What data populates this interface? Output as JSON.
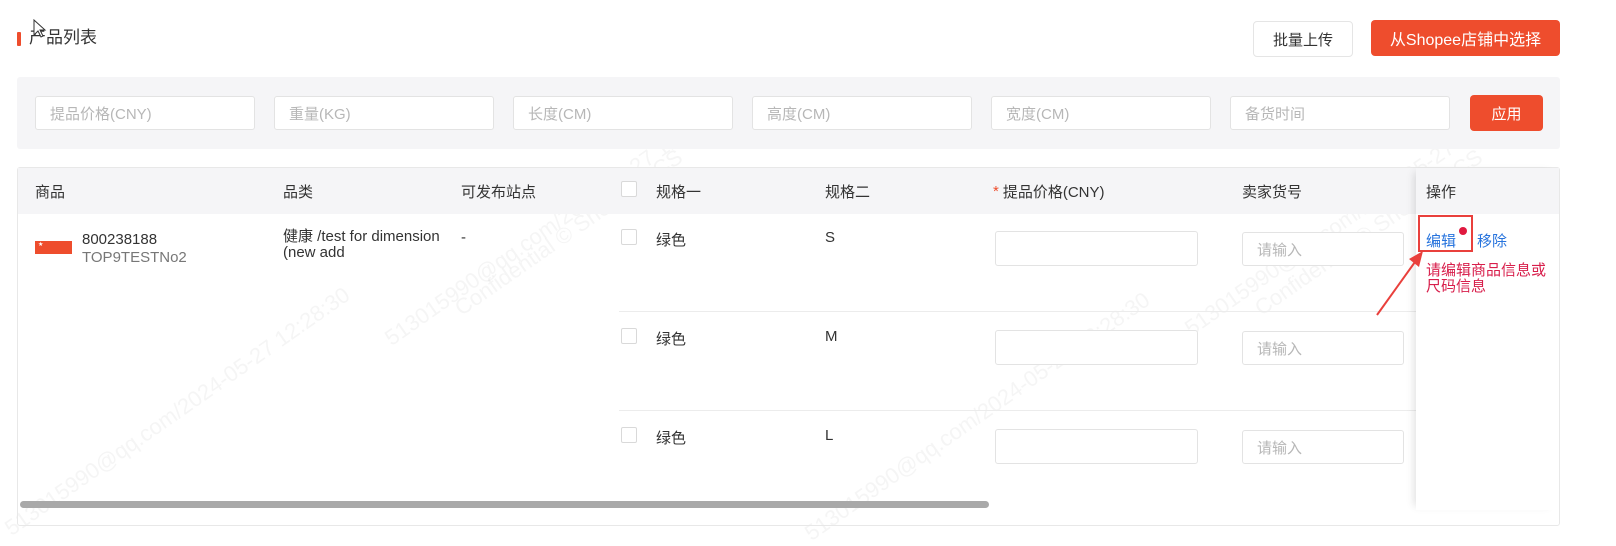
{
  "header": {
    "title": "产品列表",
    "batch_upload_label": "批量上传",
    "select_from_shop_label": "从Shopee店铺中选择"
  },
  "filters": {
    "placeholders": [
      "提品价格(CNY)",
      "重量(KG)",
      "长度(CM)",
      "高度(CM)",
      "宽度(CM)",
      "备货时间"
    ],
    "apply_label": "应用"
  },
  "table": {
    "headers": {
      "product": "商品",
      "category": "品类",
      "sites": "可发布站点",
      "spec1": "规格一",
      "spec2": "规格二",
      "price_required_mark": "*",
      "price": "提品价格(CNY)",
      "seller_sku": "卖家货号",
      "actions": "操作"
    },
    "product": {
      "id": "800238188",
      "sku": "TOP9TESTNo2",
      "category": "健康 /test for dimension (new add",
      "sites": "-"
    },
    "variants": [
      {
        "spec1": "绿色",
        "spec2": "S",
        "price": "",
        "seller_sku_placeholder": "请输入"
      },
      {
        "spec1": "绿色",
        "spec2": "M",
        "price": "",
        "seller_sku_placeholder": "请输入"
      },
      {
        "spec1": "绿色",
        "spec2": "L",
        "price": "",
        "seller_sku_placeholder": "请输入"
      }
    ],
    "actions": {
      "edit_label": "编辑",
      "remove_label": "移除",
      "hint": "请编辑商品信息或尺码信息"
    }
  },
  "watermark": {
    "line1": "513015990@qq.com/2024-05-27 12:28:30",
    "line2": "Confidential © Shopee SCS"
  },
  "colors": {
    "brand": "#ee4d2d",
    "link": "#2673dd",
    "alert": "#e9403c",
    "hint": "#d81e4b"
  }
}
